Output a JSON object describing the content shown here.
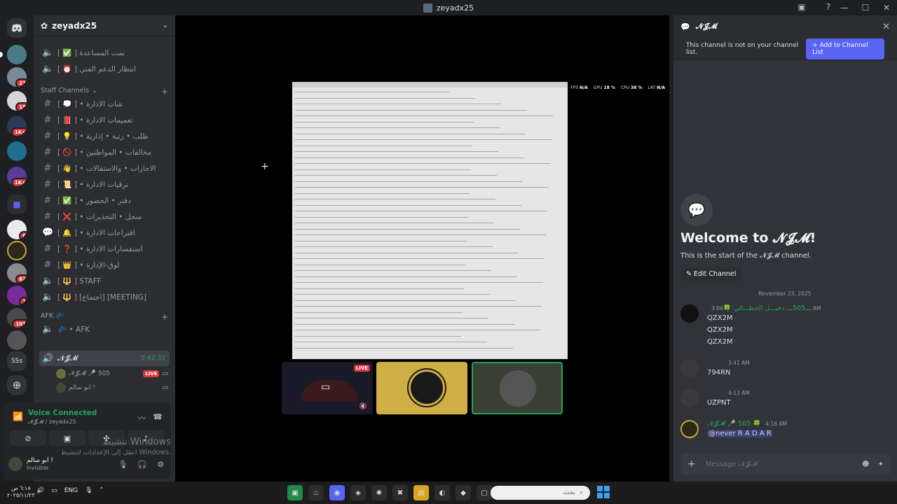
{
  "window": {
    "title": "zeyadx25"
  },
  "server_rail": {
    "badges": [
      "21",
      "15",
      "1K+",
      "1K+",
      "6",
      "62",
      "1",
      "101"
    ],
    "ssl_label": "SSs"
  },
  "sidebar": {
    "server_name": "zeyadx25",
    "top_channels": [
      {
        "label": "[ ✅ ] تمت المساعدة"
      },
      {
        "label": "[ ⏰ ] انتظار الدعم الفني"
      }
    ],
    "staff_category": "Staff Channels",
    "staff_channels": [
      {
        "label": "[ 💭 ] • شات الادارة"
      },
      {
        "label": "[ 📕 ] • تعميمات الادارة"
      },
      {
        "label": "[ 💡 ] • طلب • رتبة • إدارية"
      },
      {
        "label": "[ 🚫 ] • مخالفات • المواطنين"
      },
      {
        "label": "[ 👋 ] • الاجازات • والاستقالات"
      },
      {
        "label": "[ 📜 ] • ترقيات الادارة"
      },
      {
        "label": "[ ✅ ] • دفتر • الحضور"
      },
      {
        "label": "[ ❌ ] • سجل • التحذيرات"
      },
      {
        "label": "[ 🔔 ] • اقتراحات الادارة"
      },
      {
        "label": "[ ❓ ] • استفسارات الادارة"
      },
      {
        "label": "[ 👑 ] • لوق-الإدارة"
      },
      {
        "label": "[ 🔱 ] STAFF"
      },
      {
        "label": "[ 🔱 ] [اجتماع] [MEETING]"
      }
    ],
    "afk_category": "AFK 💤",
    "afk_channel": "💤 • AFK",
    "active_voice": {
      "label": "𝓝𝓙𝓜",
      "time": "5:42:33"
    },
    "voice_users": [
      {
        "name": "𝓝𝓙𝓜 🎤 505",
        "live": "LIVE"
      },
      {
        "name": "ابو سالم !"
      }
    ]
  },
  "voice_panel": {
    "status": "Voice Connected",
    "location": "𝓝𝓙𝓜 / zeyadx25"
  },
  "user": {
    "name": "ابو سالم !",
    "status": "Invisible"
  },
  "watermark": {
    "line1": "تنشيط Windows",
    "line2": "انتقل إلى الإعدادات لتنشيط Windows."
  },
  "stream": {
    "stats": [
      {
        "label": "FPS",
        "value": "N/A"
      },
      {
        "label": "GPU",
        "value": "18 %"
      },
      {
        "label": "CPU",
        "value": "38 %"
      },
      {
        "label": "LAT",
        "value": "N/A"
      }
    ],
    "tile_live": "LIVE"
  },
  "right_panel": {
    "channel_name": "𝓝𝓙𝓜",
    "notice": "This channel is not on your channel list.",
    "add_button": "Add to Channel List",
    "welcome_title": "Welcome to 𝓝𝓙𝓜!",
    "welcome_sub": "This is the start of the 𝓝𝓙𝓜 channel.",
    "edit_button": "Edit Channel",
    "date_divider": "November 23, 2025",
    "messages": [
      {
        "author": "ـــ505ـــ دخيـــل الخطـــالي 🍀",
        "time": "3:06 AM",
        "lines": [
          "QZX2M",
          "QZX2M",
          "QZX2M"
        ]
      },
      {
        "author": "",
        "time": "3:41 AM",
        "lines": [
          "794RN"
        ]
      },
      {
        "author": "",
        "time": "4:13 AM",
        "lines": [
          "UZPNT"
        ]
      },
      {
        "author": "𝓝𝓙𝓜 🎤 505 🍀",
        "time": "4:16 AM",
        "lines": [
          "@never R A D A R"
        ]
      }
    ],
    "composer_placeholder": "Message 𝓝𝓙𝓜"
  },
  "taskbar": {
    "time": "٦:١٨ ص",
    "date": "٢٠٢٥/١١/٢٣",
    "lang": "ENG",
    "search_placeholder": "بحث"
  }
}
